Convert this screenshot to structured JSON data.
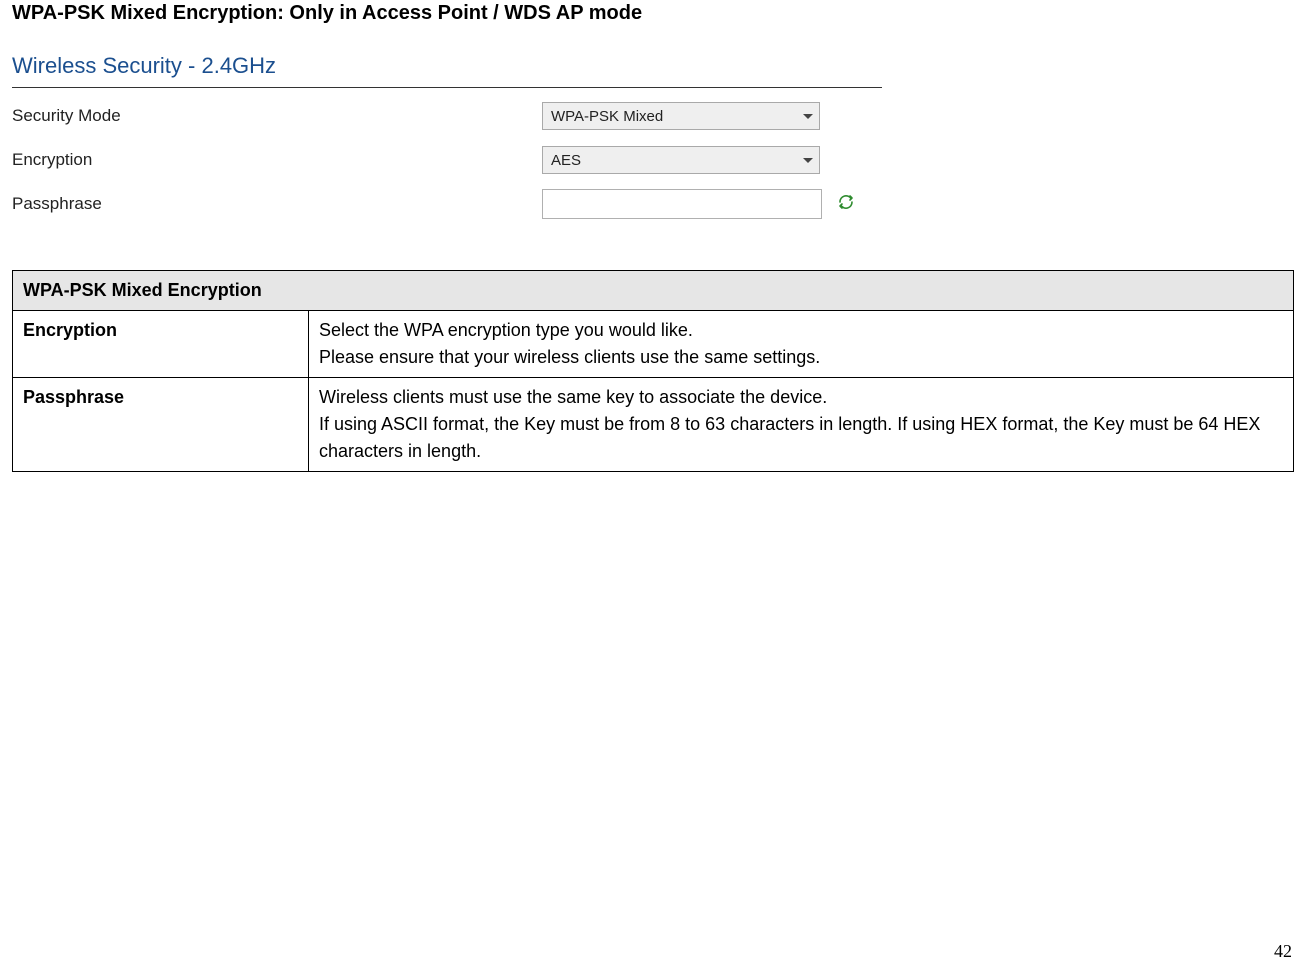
{
  "page_title": "WPA-PSK Mixed Encryption: Only in Access Point / WDS AP mode",
  "screenshot": {
    "heading": "Wireless Security - 2.4GHz",
    "rows": {
      "security_mode": {
        "label": "Security Mode",
        "value": "WPA-PSK Mixed"
      },
      "encryption": {
        "label": "Encryption",
        "value": "AES"
      },
      "passphrase": {
        "label": "Passphrase",
        "value": ""
      }
    }
  },
  "table": {
    "header": "WPA-PSK Mixed Encryption",
    "rows": [
      {
        "col1": "Encryption",
        "col2": "Select the WPA encryption type you would like.\nPlease ensure that your wireless clients use the same settings."
      },
      {
        "col1": "Passphrase",
        "col2": "Wireless clients must use the same key to associate the device.\nIf using ASCII format, the Key must be from 8 to 63 characters in length. If using HEX format, the Key must be 64 HEX characters in length."
      }
    ]
  },
  "page_number": "42"
}
